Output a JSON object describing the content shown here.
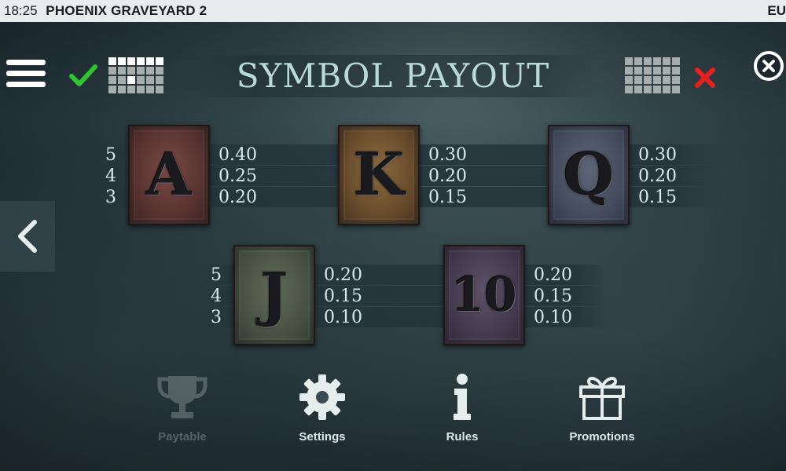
{
  "status_bar": {
    "time": "18:25",
    "game_title": "PHOENIX GRAVEYARD 2",
    "currency": "EU"
  },
  "header": {
    "title": "SYMBOL PAYOUT"
  },
  "colors": {
    "accent_check": "#2fc52f",
    "accent_x": "#e81f1f",
    "title_color": "#b9dad8"
  },
  "payouts": [
    {
      "symbol": "A",
      "pays": [
        {
          "count": "5",
          "value": "0.40"
        },
        {
          "count": "4",
          "value": "0.25"
        },
        {
          "count": "3",
          "value": "0.20"
        }
      ]
    },
    {
      "symbol": "K",
      "pays": [
        {
          "count": "",
          "value": "0.30"
        },
        {
          "count": "",
          "value": "0.20"
        },
        {
          "count": "",
          "value": "0.15"
        }
      ]
    },
    {
      "symbol": "Q",
      "pays": [
        {
          "count": "",
          "value": "0.30"
        },
        {
          "count": "",
          "value": "0.20"
        },
        {
          "count": "",
          "value": "0.15"
        }
      ]
    },
    {
      "symbol": "J",
      "pays": [
        {
          "count": "5",
          "value": "0.20"
        },
        {
          "count": "4",
          "value": "0.15"
        },
        {
          "count": "3",
          "value": "0.10"
        }
      ]
    },
    {
      "symbol": "10",
      "pays": [
        {
          "count": "",
          "value": "0.20"
        },
        {
          "count": "",
          "value": "0.15"
        },
        {
          "count": "",
          "value": "0.10"
        }
      ]
    }
  ],
  "nav": {
    "paytable": "Paytable",
    "settings": "Settings",
    "rules": "Rules",
    "promotions": "Promotions"
  },
  "icons": {
    "menu": "hamburger-menu-icon",
    "check": "checkmark-icon",
    "grid": "payline-grid-icon",
    "x": "x-icon",
    "close": "close-circle-icon",
    "back": "chevron-left-icon",
    "paytable": "trophy-icon",
    "settings": "gear-icon",
    "rules": "info-icon",
    "promotions": "gift-icon"
  }
}
